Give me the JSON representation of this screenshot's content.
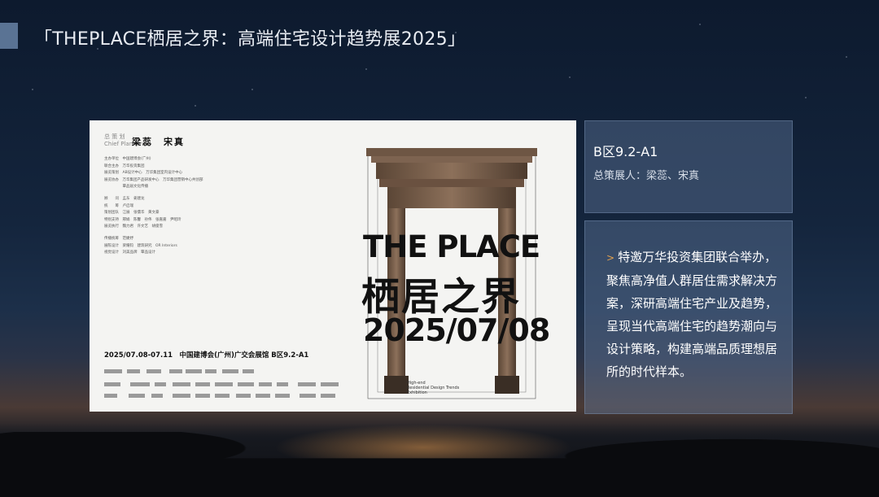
{
  "header": {
    "title": "「THEPLACE栖居之界：高端住宅设计趋势展2025」"
  },
  "poster": {
    "plan_label_cn": "总 策 划",
    "plan_label_en": "Chief Planner",
    "planners": "梁蕊　宋真",
    "credits": [
      "主办单位　中国建博会(广州)",
      "联合主办　万华投资集团",
      "展览策划　AB设计中心　万华集团室内设计中心",
      "展览协办　万华集团产品研发中心　万华集团营销中心共创部",
      "　　　　　覃品居文化传播",
      "",
      "顾　　问　孟东　姜建龙",
      "统　　筹　卢启瑞",
      "策划团队　江展　张儒华　黄文豪",
      "特别支持　邢娟　陈馨　孙伟　张嘉嘉　尹昭玲",
      "展览执行　魏力君　许文艺　胡俊雪",
      "",
      "传播统筹　范婕妤",
      "展陈设计　梁耀钧　建筑研究　OR Interiors",
      "视觉设计　刘美品牌　覃品设计"
    ],
    "date_venue": "2025/07.08-07.11　中国建博会(广州)广交会展馆 B区9.2-A1",
    "brand_en": "THE PLACE",
    "brand_cn": "栖居之界",
    "big_date": "2025/07/08",
    "exhibition_en": [
      "High-end",
      "Residential Design Trends",
      "Exhibition"
    ]
  },
  "info_card": {
    "area": "B区9.2-A1",
    "curator": "总策展人：梁蕊、宋真"
  },
  "desc_card": {
    "bullet": ">",
    "text": "特邀万华投资集团联合举办，聚焦高净值人群居住需求解决方案，深研高端住宅产业及趋势，呈现当代高端住宅的趋势潮向与设计策略，构建高端品质理想居所的时代样本。"
  },
  "colors": {
    "accent_bar": "#5a7394",
    "bullet": "#e2a24e",
    "card_bg": "rgba(100,125,160,0.42)"
  }
}
